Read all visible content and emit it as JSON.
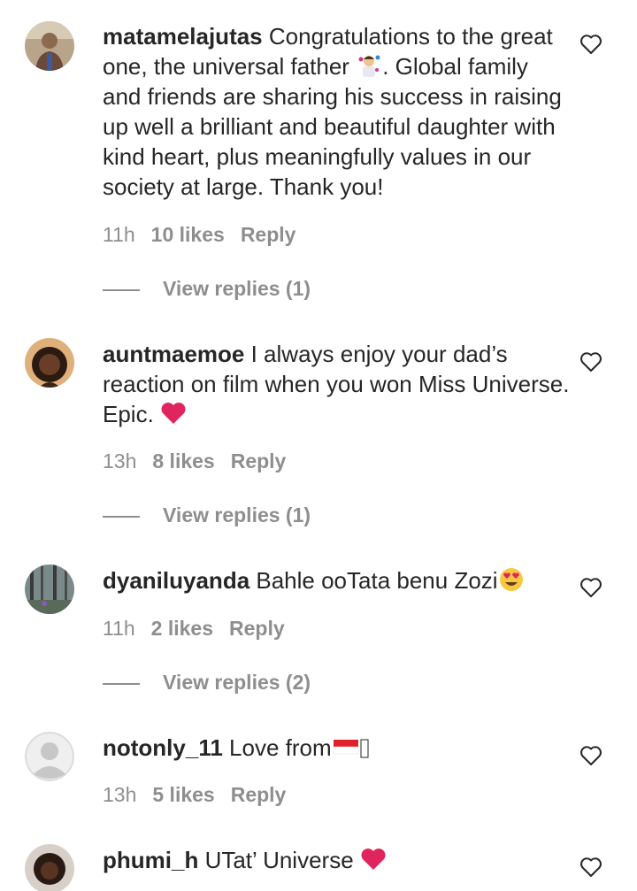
{
  "comments": [
    {
      "username": "matamelajutas",
      "text_a": " Congratulations to the great one, the universal father ",
      "text_b": ". Global family and friends are sharing his success in raising up well a brilliant and beautiful daughter with kind heart, plus meaningfully values in our society at large. Thank you!",
      "time": "11h",
      "likes": "10 likes",
      "reply": "Reply",
      "view_replies": "View replies (1)",
      "icon": "old-man-avatar"
    },
    {
      "username": "auntmaemoe",
      "text_a": " I always enjoy your dad’s reaction on film when you won Miss Universe. Epic. ",
      "time": "13h",
      "likes": "8 likes",
      "reply": "Reply",
      "view_replies": "View replies (1)",
      "icon": "red-heart-emoji"
    },
    {
      "username": "dyaniluyanda",
      "text_a": " Bahle ooTata benu Zozi",
      "time": "11h",
      "likes": "2 likes",
      "reply": "Reply",
      "view_replies": "View replies (2)",
      "icon": "heart-eyes-emoji"
    },
    {
      "username": "notonly_11",
      "text_a": " Love from",
      "time": "13h",
      "likes": "5 likes",
      "reply": "Reply",
      "icon": "indonesia-flag-emoji"
    },
    {
      "username": "phumi_h",
      "text_a": " UTat’ Universe ",
      "icon": "red-heart-emoji"
    }
  ],
  "colors": {
    "text": "#262626",
    "muted": "#8e8e8e",
    "heart": "#e0245e"
  }
}
